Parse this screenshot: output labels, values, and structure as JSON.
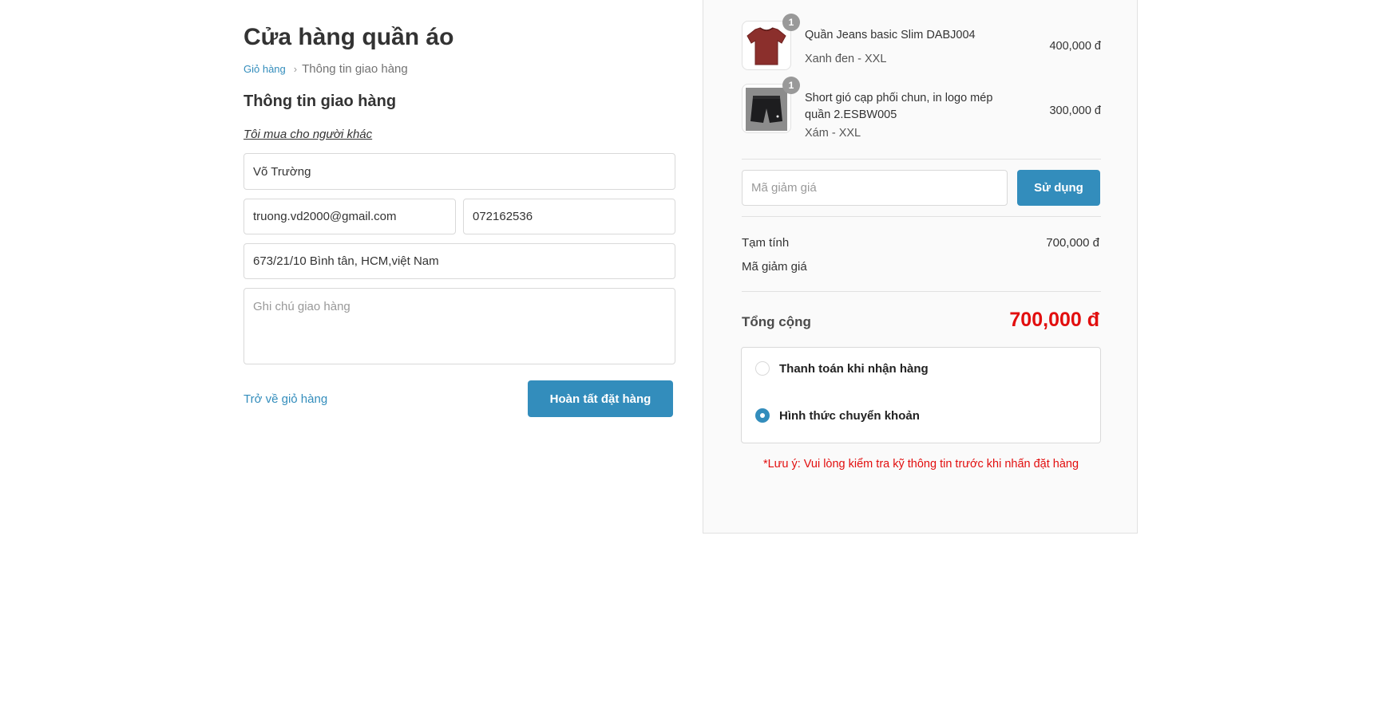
{
  "store": {
    "title": "Cửa hàng quần áo"
  },
  "breadcrumb": {
    "cart_link": "Giỏ hàng",
    "current": "Thông tin giao hàng"
  },
  "form": {
    "section_title": "Thông tin giao hàng",
    "other_buyer_link": "Tôi mua cho người khác",
    "name_value": "Võ Trường",
    "email_value": "truong.vd2000@gmail.com",
    "phone_value": "072162536",
    "address_value": "673/21/10 Bình tân, HCM,việt Nam",
    "note_placeholder": "Ghi chú giao hàng",
    "back_link": "Trở về giỏ hàng",
    "submit_label": "Hoàn tất đặt hàng"
  },
  "order": {
    "items": [
      {
        "name": "Quần Jeans basic Slim DABJ004",
        "variant": "Xanh đen - XXL",
        "price": "400,000 đ",
        "quantity": "1",
        "thumb_icon": "red-tshirt-image"
      },
      {
        "name": "Short gió cạp phối chun, in logo mép quần 2.ESBW005",
        "variant": "Xám - XXL",
        "price": "300,000 đ",
        "quantity": "1",
        "thumb_icon": "black-shorts-image"
      }
    ],
    "coupon_placeholder": "Mã giảm giá",
    "coupon_button": "Sử dụng",
    "subtotal_label": "Tạm tính",
    "subtotal_value": "700,000 đ",
    "discount_label": "Mã giảm giá",
    "discount_value": "",
    "total_label": "Tổng cộng",
    "total_value": "700,000 đ"
  },
  "payment": {
    "options": [
      {
        "label": "Thanh toán khi nhận hàng",
        "selected": false
      },
      {
        "label": "Hình thức chuyển khoản",
        "selected": true
      }
    ],
    "note": "*Lưu ý: Vui lòng kiểm tra kỹ thông tin trước khi nhấn đặt hàng"
  },
  "colors": {
    "accent": "#338dbc",
    "total": "#e20e0e",
    "sidebar_bg": "#fafafa"
  }
}
